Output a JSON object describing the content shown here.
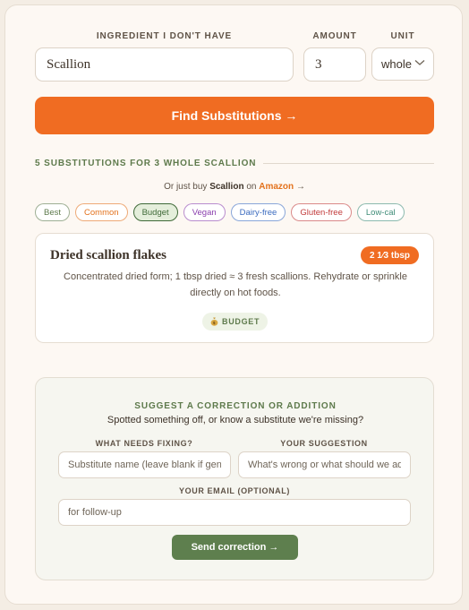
{
  "form": {
    "ingredient_label": "INGREDIENT I DON'T HAVE",
    "ingredient_value": "Scallion",
    "amount_label": "AMOUNT",
    "amount_value": "3",
    "unit_label": "UNIT",
    "unit_value": "whole",
    "find_button": "Find Substitutions →"
  },
  "results": {
    "heading": "5 SUBSTITUTIONS FOR 3 WHOLE SCALLION",
    "buy_prefix": "Or just buy",
    "buy_item": "Scallion",
    "buy_on": "on",
    "buy_store": "Amazon",
    "buy_arrow": "→",
    "filters": [
      {
        "label": "Best",
        "color": "#5e7a4c",
        "active": false
      },
      {
        "label": "Common",
        "color": "#e3721d",
        "active": false
      },
      {
        "label": "Budget",
        "color": "#3f6a38",
        "active": true
      },
      {
        "label": "Vegan",
        "color": "#8a3fae",
        "active": false
      },
      {
        "label": "Dairy-free",
        "color": "#3b6bbf",
        "active": false
      },
      {
        "label": "Gluten-free",
        "color": "#c23b3b",
        "active": false
      },
      {
        "label": "Low-cal",
        "color": "#3f8c78",
        "active": false
      }
    ],
    "item": {
      "title": "Dried scallion flakes",
      "amount": "2 1⁄3 tbsp",
      "description": "Concentrated dried form; 1 tbsp dried ≈ 3 fresh scallions. Rehydrate or sprinkle directly on hot foods.",
      "tag": "BUDGET",
      "tag_icon": "money-bag-icon"
    }
  },
  "suggest": {
    "title": "SUGGEST A CORRECTION OR ADDITION",
    "subtitle": "Spotted something off, or know a substitute we're missing?",
    "fix_label": "WHAT NEEDS FIXING?",
    "fix_placeholder": "Substitute name (leave blank if general)",
    "suggestion_label": "YOUR SUGGESTION",
    "suggestion_placeholder": "What's wrong or what should we add?",
    "email_label": "YOUR EMAIL (OPTIONAL)",
    "email_placeholder": "for follow-up",
    "send_button": "Send correction →"
  },
  "colors": {
    "accent": "#f06c22",
    "green": "#5e7f4e",
    "background": "#fdf8f3"
  }
}
